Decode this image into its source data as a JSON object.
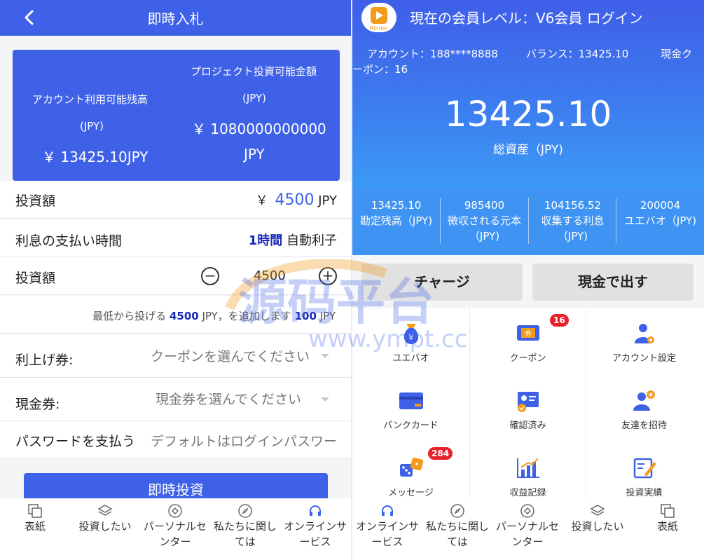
{
  "left": {
    "header": {
      "title": "即時入札"
    },
    "card": {
      "project_label": "プロジェクト投資可能金額",
      "project_unit": "(JPY)",
      "project_value": "￥ 1080000000000",
      "project_cur": "JPY",
      "account_label": "アカウント利用可能残高",
      "account_unit": "(JPY)",
      "account_value": "￥ 13425.10JPY"
    },
    "invest_amount": {
      "label": "投資額",
      "currency": "￥",
      "value": "4500",
      "unit": "JPY"
    },
    "interest_time": {
      "label": "利息の支払い時間",
      "value_bold": "1時間",
      "value_rest": "自動利子"
    },
    "stepper": {
      "label": "投資額",
      "minus": "−",
      "value": "4500",
      "plus": "+"
    },
    "hint": {
      "p1": "最低から投げる",
      "min": "4500",
      "p2": "JPY，を追加します",
      "step": "100",
      "p3": "JPY"
    },
    "coupon": {
      "label": "利上げ券:",
      "placeholder": "クーポンを選んでください"
    },
    "cash": {
      "label": "現金券:",
      "placeholder": "現金券を選んでください"
    },
    "password": {
      "label": "パスワードを支払う",
      "placeholder": "デフォルトはログインパスワー"
    },
    "submit_label": "即時投資",
    "tabs": [
      {
        "label": "表紙"
      },
      {
        "label": "投資したい"
      },
      {
        "label": "パーソナルセンター"
      },
      {
        "label": "私たちに関しては"
      },
      {
        "label": "オンラインサービス"
      }
    ]
  },
  "right": {
    "title": "現在の会員レベル：V6会員  ログイン",
    "logo_text": "Rinder",
    "account": "アカウント：188****8888",
    "balance": "バランス：13425.10",
    "coupon_line1": "現金ク",
    "coupon_line2": "ーポン：16",
    "total": "13425.10",
    "total_label": "総資産（JPY)",
    "stats": [
      {
        "value": "13425.10",
        "label": "勘定残高（JPY)"
      },
      {
        "value": "985400",
        "label": "徴収される元本（JPY)"
      },
      {
        "value": "104156.52",
        "label": "収集する利息（JPY)"
      },
      {
        "value": "200004",
        "label": "ユエバオ（JPY)"
      }
    ],
    "charge_label": "チャージ",
    "withdraw_label": "現金で出す",
    "grid": [
      {
        "label": "ユエバオ"
      },
      {
        "label": "クーポン",
        "badge": "16"
      },
      {
        "label": "アカウント設定"
      },
      {
        "label": "バンクカード"
      },
      {
        "label": "確認済み"
      },
      {
        "label": "友達を招待"
      },
      {
        "label": "メッセージ",
        "badge": "284"
      },
      {
        "label": "収益記録"
      },
      {
        "label": "投資実績"
      }
    ],
    "tabs": [
      {
        "label": "オンラインサービス"
      },
      {
        "label": "私たちに関しては"
      },
      {
        "label": "パーソナルセンター"
      },
      {
        "label": "投資したい"
      },
      {
        "label": "表紙"
      }
    ]
  },
  "watermark": {
    "text": "源码平台",
    "url": "www.ympt.cc"
  },
  "colors": {
    "primary": "#3e61e8",
    "badge": "#e8202a",
    "highlight": "#1a28b8"
  }
}
